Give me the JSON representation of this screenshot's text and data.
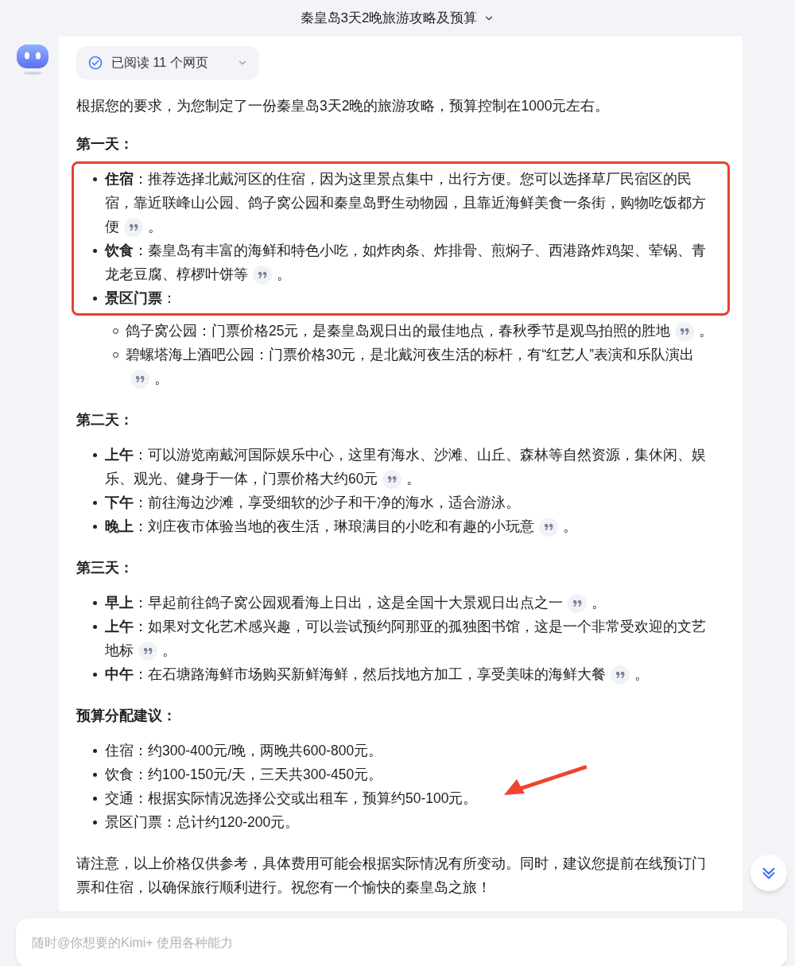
{
  "title": "秦皇岛3天2晚旅游攻略及预算",
  "sources_chip": {
    "label": "已阅读 11 个网页",
    "expanded": false
  },
  "intro": "根据您的要求，为您制定了一份秦皇岛3天2晚的旅游攻略，预算控制在1000元左右。",
  "sections": [
    {
      "heading": "第一天：",
      "highlight_box": true,
      "items": [
        {
          "label": "住宿",
          "text": "：推荐选择北戴河区的住宿，因为这里景点集中，出行方便。您可以选择草厂民宿区的民宿，靠近联峰山公园、鸽子窝公园和秦皇岛野生动物园，且靠近海鲜美食一条街，购物吃饭都方便",
          "cite": true,
          "tail": "。"
        },
        {
          "label": "饮食",
          "text": "：秦皇岛有丰富的海鲜和特色小吃，如炸肉条、炸排骨、煎焖子、西港路炸鸡架、荤锅、青龙老豆腐、椁椤叶饼等",
          "cite": true,
          "tail": "。"
        },
        {
          "label": "景区门票",
          "text": "：",
          "cite": false,
          "children": [
            {
              "text": "鸽子窝公园：门票价格25元，是秦皇岛观日出的最佳地点，春秋季节是观鸟拍照的胜地",
              "cite": true,
              "tail": "。"
            },
            {
              "text": "碧螺塔海上酒吧公园：门票价格30元，是北戴河夜生活的标杆，有“红艺人”表演和乐队演出",
              "cite": true,
              "tail": "。"
            }
          ]
        }
      ]
    },
    {
      "heading": "第二天：",
      "items": [
        {
          "label": "上午",
          "text": "：可以游览南戴河国际娱乐中心，这里有海水、沙滩、山丘、森林等自然资源，集休闲、娱乐、观光、健身于一体，门票价格大约60元",
          "cite": true,
          "tail": "。"
        },
        {
          "label": "下午",
          "text": "：前往海边沙滩，享受细软的沙子和干净的海水，适合游泳。",
          "cite": false
        },
        {
          "label": "晚上",
          "text": "：刘庄夜市体验当地的夜生活，琳琅满目的小吃和有趣的小玩意",
          "cite": true,
          "tail": "。"
        }
      ]
    },
    {
      "heading": "第三天：",
      "items": [
        {
          "label": "早上",
          "text": "：早起前往鸽子窝公园观看海上日出，这是全国十大景观日出点之一",
          "cite": true,
          "tail": "。"
        },
        {
          "label": "上午",
          "text": "：如果对文化艺术感兴趣，可以尝试预约阿那亚的孤独图书馆，这是一个非常受欢迎的文艺地标",
          "cite": true,
          "tail": "。"
        },
        {
          "label": "中午",
          "text": "：在石塘路海鲜市场购买新鲜海鲜，然后找地方加工，享受美味的海鲜大餐",
          "cite": true,
          "tail": "。"
        }
      ]
    },
    {
      "heading": "预算分配建议：",
      "items": [
        {
          "text": "住宿：约300-400元/晚，两晚共600-800元。",
          "cite": false
        },
        {
          "text": "饮食：约100-150元/天，三天共300-450元。",
          "cite": false
        },
        {
          "text": "交通：根据实际情况选择公交或出租车，预算约50-100元。",
          "cite": false
        },
        {
          "text": "景区门票：总计约120-200元。",
          "cite": false
        }
      ]
    }
  ],
  "closing": "请注意，以上价格仅供参考，具体费用可能会根据实际情况有所变动。同时，建议您提前在线预订门票和住宿，以确保旅行顺利进行。祝您有一个愉快的秦皇岛之旅！",
  "annotation_arrow": true,
  "input": {
    "placeholder": "随时@你想要的Kimi+ 使用各种能力"
  }
}
